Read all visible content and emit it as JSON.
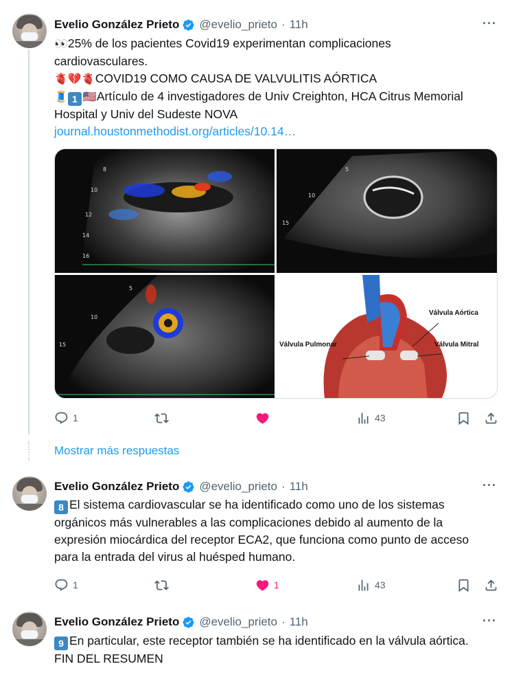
{
  "author": {
    "name": "Evelio González Prieto",
    "handle": "@evelio_prieto",
    "separator": "·"
  },
  "tweets": [
    {
      "time": "11h",
      "lines": [
        "25% de los pacientes Covid19 experimentan complicaciones",
        "cardiovasculares.",
        "COVID19 COMO CAUSA DE VALVULITIS AÓRTICA",
        "Artículo de 4 investigadores de Univ Creighton, HCA Citrus Memorial",
        "Hospital y Univ del Sudeste NOVA",
        "journal.houstonmethodist.org/articles/10.14…"
      ],
      "emoji": {
        "eyes": "👀",
        "hearts": "🫀💔🫀",
        "tag_emoji": "🧵",
        "keycap": "1",
        "flag": "🇺🇸"
      },
      "media_labels": {
        "aortic_valve": "Válvula Aórtica",
        "pulmonary_valve": "Válvula Pulmonar",
        "mitral_valve": "Válvula Mitral",
        "tick_labels": [
          "8",
          "10",
          "12",
          "14",
          "16",
          "5",
          "10",
          "15",
          "5",
          "10",
          "15"
        ]
      },
      "stats": {
        "replies": "1",
        "retweets": "",
        "likes": "",
        "views": "43"
      },
      "liked": true
    },
    {
      "time": "11h",
      "keycap": "8",
      "lines": [
        "El sistema cardiovascular se ha identificado como uno de los sistemas",
        "orgánicos más vulnerables a las complicaciones debido al aumento de la",
        "expresión miocárdica del receptor ECA2, que funciona como punto de acceso",
        "para la entrada del virus al huésped humano."
      ],
      "stats": {
        "replies": "1",
        "retweets": "",
        "likes": "1",
        "views": "43"
      },
      "liked": true
    },
    {
      "time": "11h",
      "keycap": "9",
      "lines": [
        "En particular, este receptor también se ha identificado en la válvula aórtica.",
        "FIN DEL RESUMEN"
      ]
    }
  ],
  "show_more_replies": "Mostrar más respuestas",
  "more_menu": "···",
  "colors": {
    "accent": "#1d9bf0",
    "like": "#f91880",
    "muted": "#536471",
    "verified": "#1d9bf0"
  }
}
